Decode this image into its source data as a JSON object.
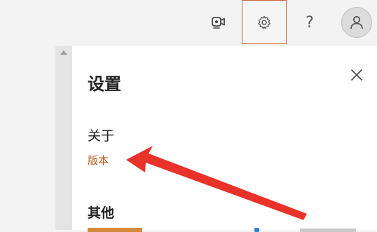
{
  "topbar": {
    "meet_icon": "meet-now-icon",
    "settings_icon": "gear-icon",
    "help_label": "?",
    "avatar_icon": "person-icon"
  },
  "panel": {
    "title": "设置",
    "close_icon": "close-icon",
    "about_heading": "关于",
    "version_link": "版本",
    "other_heading": "其他"
  },
  "colors": {
    "accent": "#c25a1d",
    "settings_highlight_border": "#c9633a",
    "annotation_arrow": "#e8322a"
  }
}
